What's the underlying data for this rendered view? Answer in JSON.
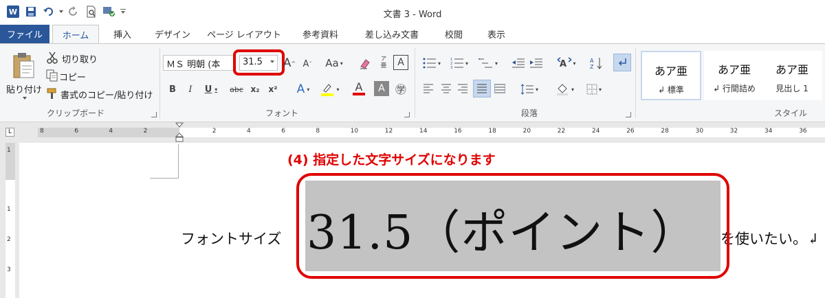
{
  "window": {
    "title": "文書 3 - Word"
  },
  "qat": {
    "app_logo": "W",
    "icons": [
      "save-icon",
      "undo-icon",
      "redo-icon",
      "print-preview-icon",
      "touch-mode-icon",
      "customize-qat-icon"
    ]
  },
  "tabs": {
    "file": "ファイル",
    "items": [
      "ホーム",
      "挿入",
      "デザイン",
      "ページ レイアウト",
      "参考資料",
      "差し込み文書",
      "校閲",
      "表示"
    ],
    "active": "ホーム"
  },
  "clipboard": {
    "paste": "貼り付け",
    "cut": "切り取り",
    "copy": "コピー",
    "format_painter": "書式のコピー/貼り付け",
    "group": "クリップボード"
  },
  "font": {
    "font_name": "ＭＳ 明朝 (本",
    "font_size": "31.5",
    "group": "フォント",
    "bold": "B",
    "italic": "I",
    "underline": "U",
    "strikethrough": "abc",
    "subscript": "x₂",
    "superscript": "x²",
    "change_case": "Aa",
    "grow": "A",
    "shrink": "A",
    "font_color": "A",
    "effects": "A",
    "shading": "A",
    "enclose": "㊫",
    "phonetic_guide": "亜",
    "border_char": "A"
  },
  "paragraph": {
    "group": "段落"
  },
  "styles": {
    "group": "スタイル",
    "items": [
      {
        "sample": "あア亜",
        "name": "↲ 標準"
      },
      {
        "sample": "あア亜",
        "name": "↲ 行間詰め"
      },
      {
        "sample": "あア亜",
        "name": "見出し 1"
      }
    ]
  },
  "ruler": {
    "h_ticks": [
      "8",
      "6",
      "4",
      "2",
      "2",
      "4",
      "6",
      "8",
      "10",
      "12",
      "14",
      "16",
      "18",
      "20",
      "22",
      "24",
      "26",
      "28",
      "30",
      "32",
      "34",
      "36"
    ],
    "v_ticks": [
      "1",
      "1",
      "2",
      "3"
    ],
    "tab_marker": "L"
  },
  "document": {
    "annotation": "(4) 指定した文字サイズになります",
    "text_before": "フォントサイズ",
    "selected_text": "31.5（ポイント）",
    "text_after": "を使いたい。↲"
  },
  "colors": {
    "accent": "#2b579a",
    "highlight": "#e00000",
    "selection": "#c3c3c3"
  }
}
